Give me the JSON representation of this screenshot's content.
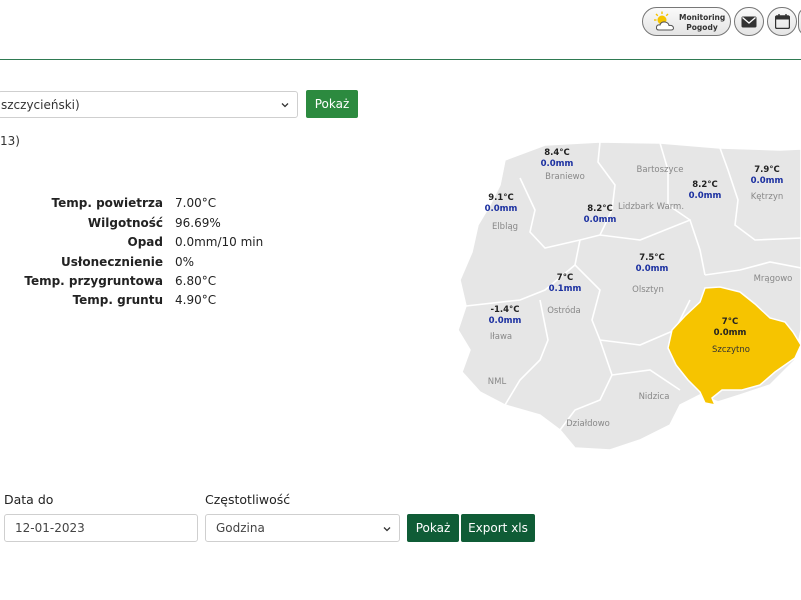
{
  "header": {
    "monitoring_line1": "Monitoring",
    "monitoring_line2": "Pogody",
    "icons": [
      "weather-sun-cloud-icon",
      "mail-icon",
      "calendar-icon"
    ]
  },
  "station_select": {
    "value": "szczycieński)"
  },
  "show_button_top": "Pokaż",
  "partial_text": "13)",
  "measurements": [
    {
      "label": "Temp. powietrza",
      "value": "7.00°C"
    },
    {
      "label": "Wilgotność",
      "value": "96.69%"
    },
    {
      "label": "Opad",
      "value": "0.0mm/10 min"
    },
    {
      "label": "Usłonecznienie",
      "value": "0%"
    },
    {
      "label": "Temp. przygruntowa",
      "value": "6.80°C"
    },
    {
      "label": "Temp. gruntu",
      "value": "4.90°C"
    }
  ],
  "map": {
    "regions": [
      {
        "name": "Braniewo",
        "temp": "8.4°C",
        "precip": "0.0mm",
        "highlight": false
      },
      {
        "name": "Bartoszyce",
        "temp": "",
        "precip": "",
        "highlight": false
      },
      {
        "name": "Kętrzyn",
        "temp": "7.9°C",
        "precip": "0.0mm",
        "highlight": false
      },
      {
        "name": "Lidzbark Warm.",
        "temp": "8.2°C",
        "precip": "0.0mm",
        "highlight": false
      },
      {
        "name": "Elbląg",
        "temp": "9.1°C",
        "precip": "0.0mm",
        "highlight": false
      },
      {
        "name": "Ostróda",
        "temp": "7°C",
        "precip": "0.1mm",
        "highlight": false
      },
      {
        "name": "Olsztyn",
        "temp": "7.5°C",
        "precip": "0.0mm",
        "highlight": false
      },
      {
        "name": "Iława",
        "temp": "-1.4°C",
        "precip": "0.0mm",
        "highlight": false
      },
      {
        "name": "Mrągowo",
        "temp": "",
        "precip": "",
        "highlight": false
      },
      {
        "name": "Szczytno",
        "temp": "7°C",
        "precip": "0.0mm",
        "highlight": true
      },
      {
        "name": "NML",
        "temp": "",
        "precip": "",
        "highlight": false
      },
      {
        "name": "Nidzica",
        "temp": "",
        "precip": "",
        "highlight": false
      },
      {
        "name": "Działdowo",
        "temp": "",
        "precip": "",
        "highlight": false
      }
    ],
    "extra_temp_bartoszyce_east": {
      "temp": "8.2°C",
      "precip": "0.0mm"
    },
    "colors": {
      "region": "#e6e6e6",
      "border": "#ffffff",
      "highlight": "#f6c400",
      "precip": "#1a2fa0"
    }
  },
  "form": {
    "date_to_label": "Data do",
    "date_to_value": "12-01-2023",
    "frequency_label": "Częstotliwość",
    "frequency_value": "Godzina",
    "show_button": "Pokaż",
    "export_button": "Export xls"
  }
}
